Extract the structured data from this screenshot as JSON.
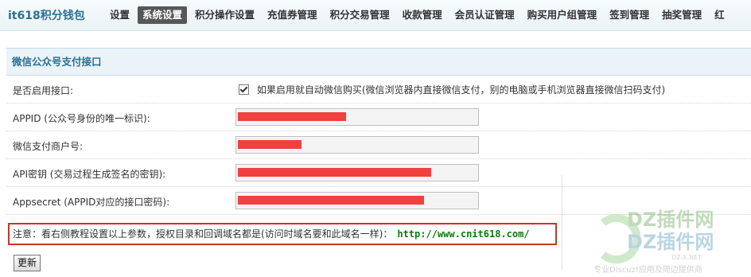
{
  "brand": "it618积分钱包",
  "nav": [
    {
      "label": "设置",
      "active": false
    },
    {
      "label": "系统设置",
      "active": true
    },
    {
      "label": "积分操作设置",
      "active": false
    },
    {
      "label": "充值券管理",
      "active": false
    },
    {
      "label": "积分交易管理",
      "active": false
    },
    {
      "label": "收款管理",
      "active": false
    },
    {
      "label": "会员认证管理",
      "active": false
    },
    {
      "label": "购买用户组管理",
      "active": false
    },
    {
      "label": "签到管理",
      "active": false
    },
    {
      "label": "抽奖管理",
      "active": false
    },
    {
      "label": "红",
      "active": false
    }
  ],
  "panel": {
    "title": "微信公众号支付接口",
    "enable_label": "是否启用接口:",
    "enable_text": "如果启用就自动微信购买(微信浏览器内直接微信支付，别的电脑或手机浏览器直接微信扫码支付)",
    "enable_checked": true,
    "fields": [
      {
        "label": "APPID (公众号身份的唯一标识):",
        "redacted": 0.46
      },
      {
        "label": "微信支付商户号:",
        "redacted": 0.27
      },
      {
        "label": "API密钥 (交易过程生成签名的密钥):",
        "redacted": 0.82
      },
      {
        "label": "Appsecret (APPID对应的接口密码):",
        "redacted": 0.79
      }
    ],
    "notice_text": "注意：看右侧教程设置以上参数，授权目录和回调域名都是(访问时域名要和此域名一样)：",
    "notice_url": "http://www.cnit618.com/",
    "submit_label": "更新"
  },
  "watermark": {
    "line1": "DZ插件网",
    "line2": "DZ插件网",
    "line3": "专业Discuz!应用及周边提供商",
    "mark": "DZ-X.NET"
  }
}
